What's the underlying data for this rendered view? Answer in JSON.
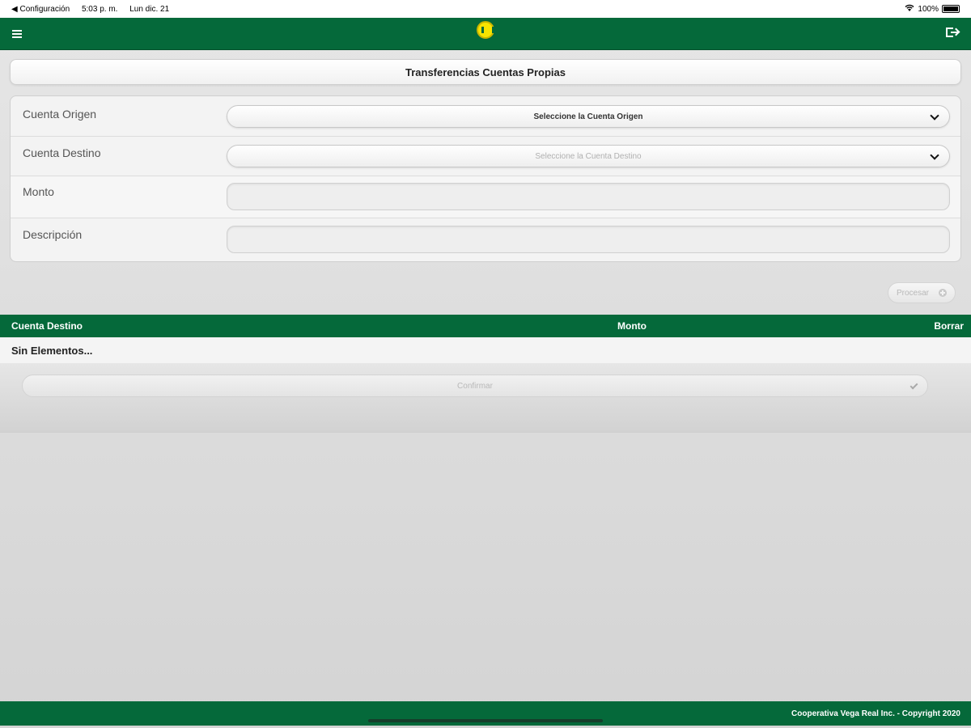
{
  "status_bar": {
    "back_app": "◀ Configuración",
    "time": "5:03 p. m.",
    "date": "Lun dic. 21",
    "battery": "100%"
  },
  "header": {
    "menu_icon": "hamburger-icon",
    "logo_icon": "cooperative-logo",
    "logout_icon": "logout-icon"
  },
  "page_title": "Transferencias Cuentas Propias",
  "form": {
    "cuenta_origen": {
      "label": "Cuenta Origen",
      "placeholder": "Seleccione la Cuenta Origen"
    },
    "cuenta_destino": {
      "label": "Cuenta Destino",
      "placeholder": "Seleccione la Cuenta Destino"
    },
    "monto": {
      "label": "Monto",
      "value": ""
    },
    "descripcion": {
      "label": "Descripción",
      "value": ""
    }
  },
  "procesar_label": "Procesar",
  "table": {
    "columns": [
      "Cuenta Destino",
      "Monto",
      "Borrar"
    ],
    "empty_text": "Sin Elementos..."
  },
  "confirmar_label": "Confirmar",
  "footer_text": "Cooperativa Vega Real Inc. - Copyright 2020",
  "colors": {
    "brand_green": "#05693a",
    "logo_yellow": "#f7e400"
  }
}
